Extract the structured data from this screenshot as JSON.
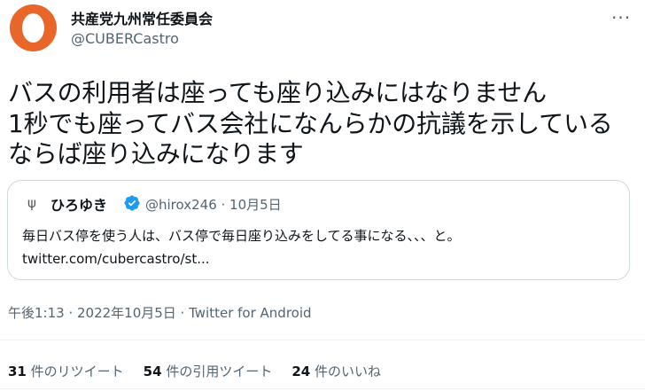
{
  "author": {
    "display_name": "共産党九州常任委員会",
    "handle": "@CUBERCastro",
    "avatar_icon": "orange-egg-avatar"
  },
  "more_icon": "···",
  "tweet_text": "バスの利用者は座っても座り込みにはなりません\n1秒でも座ってバス会社になんらかの抗議を示している\nならば座り込みになります",
  "quoted_tweet": {
    "avatar_glyph": "ψ",
    "display_name": "ひろゆき",
    "verified_icon": "verified-badge-icon",
    "handle_date": "@hirox246 · 10月5日",
    "text": "毎日バス停を使う人は、バス停で毎日座り込みをしてる事になる、、、と。",
    "link": "twitter.com/cubercastro/st..."
  },
  "meta": {
    "time_date": "午後1:13 · 2022年10月5日 · ",
    "app": "Twitter for Android"
  },
  "stats": {
    "retweets_count": "31",
    "retweets_label": "件のリツイート",
    "quotes_count": "54",
    "quotes_label": "件の引用ツイート",
    "likes_count": "24",
    "likes_label": "件のいいね"
  },
  "colors": {
    "brand_orange": "#e8662a",
    "verified_blue": "#1d9bf0",
    "secondary_text": "#536471"
  }
}
